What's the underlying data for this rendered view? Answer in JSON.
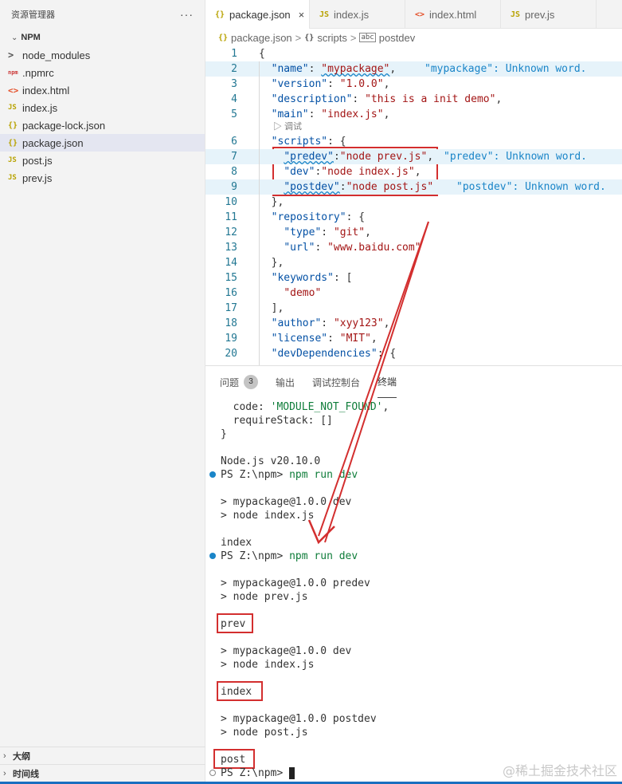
{
  "sidebar": {
    "title": "资源管理器",
    "more": "···",
    "section": "NPM",
    "items": [
      {
        "label": "node_modules",
        "icon": "chevron-right-icon",
        "glyph": ">",
        "type": "folder"
      },
      {
        "label": ".npmrc",
        "icon": "npm-icon",
        "glyph": "npm",
        "type": "npm"
      },
      {
        "label": "index.html",
        "icon": "html-icon",
        "glyph": "<>",
        "type": "html"
      },
      {
        "label": "index.js",
        "icon": "js-icon",
        "glyph": "JS",
        "type": "js"
      },
      {
        "label": "package-lock.json",
        "icon": "json-icon",
        "glyph": "{}",
        "type": "json"
      },
      {
        "label": "package.json",
        "icon": "json-icon",
        "glyph": "{}",
        "type": "json",
        "active": true
      },
      {
        "label": "post.js",
        "icon": "js-icon",
        "glyph": "JS",
        "type": "js"
      },
      {
        "label": "prev.js",
        "icon": "js-icon",
        "glyph": "JS",
        "type": "js"
      }
    ],
    "outline": "大纲",
    "timeline": "时间线"
  },
  "tabs": [
    {
      "label": "package.json",
      "glyph": "{}",
      "active": true,
      "close": "×"
    },
    {
      "label": "index.js",
      "glyph": "JS"
    },
    {
      "label": "index.html",
      "glyph": "<>"
    },
    {
      "label": "prev.js",
      "glyph": "JS"
    }
  ],
  "breadcrumb": {
    "file": "package.json",
    "sep1": ">",
    "part2": "scripts",
    "sep2": ">",
    "part3": "postdev"
  },
  "editor": {
    "codelens": "▷ 调试",
    "lines": [
      {
        "n": "1",
        "code": "{"
      },
      {
        "n": "2",
        "code": "  \"name\": \"mypackage\",",
        "warn": "\"mypackage\": Unknown word."
      },
      {
        "n": "3",
        "code": "  \"version\": \"1.0.0\","
      },
      {
        "n": "4",
        "code": "  \"description\": \"this is a init demo\","
      },
      {
        "n": "5",
        "code": "  \"main\": \"index.js\","
      },
      {
        "n": "6",
        "code": "  \"scripts\": {"
      },
      {
        "n": "7",
        "code": "    \"predev\":\"node prev.js\",",
        "warn": "\"predev\": Unknown word."
      },
      {
        "n": "8",
        "code": "    \"dev\":\"node index.js\","
      },
      {
        "n": "9",
        "code": "    \"postdev\":\"node post.js\"",
        "warn": "\"postdev\": Unknown word."
      },
      {
        "n": "10",
        "code": "  },"
      },
      {
        "n": "11",
        "code": "  \"repository\": {"
      },
      {
        "n": "12",
        "code": "    \"type\": \"git\","
      },
      {
        "n": "13",
        "code": "    \"url\": \"www.baidu.com\""
      },
      {
        "n": "14",
        "code": "  },"
      },
      {
        "n": "15",
        "code": "  \"keywords\": ["
      },
      {
        "n": "16",
        "code": "    \"demo\""
      },
      {
        "n": "17",
        "code": "  ],"
      },
      {
        "n": "18",
        "code": "  \"author\": \"xyy123\","
      },
      {
        "n": "19",
        "code": "  \"license\": \"MIT\","
      },
      {
        "n": "20",
        "code": "  \"devDependencies\": {"
      }
    ]
  },
  "panel": {
    "tabs": [
      {
        "label": "问题",
        "badge": "3"
      },
      {
        "label": "输出"
      },
      {
        "label": "调试控制台"
      },
      {
        "label": "终端",
        "active": true
      }
    ]
  },
  "terminal": {
    "lines": [
      "  code: 'MODULE_NOT_FOUND',",
      "  requireStack: []",
      "}",
      "",
      "Node.js v20.10.0",
      "PS Z:\\npm> npm run dev",
      "",
      "> mypackage@1.0.0 dev",
      "> node index.js",
      "",
      "index",
      "PS Z:\\npm> npm run dev",
      "",
      "> mypackage@1.0.0 predev",
      "> node prev.js",
      "",
      "prev",
      "",
      "> mypackage@1.0.0 dev",
      "> node index.js",
      "",
      "index",
      "",
      "> mypackage@1.0.0 postdev",
      "> node post.js",
      "",
      "post",
      "PS Z:\\npm> "
    ],
    "prompt": "PS Z:\\npm>",
    "cmd": "npm run dev",
    "module_not_found": "'MODULE_NOT_FOUND'"
  },
  "watermark": "@稀土掘金技术社区",
  "colors": {
    "annotation": "#d32f2f",
    "accent": "#1a85c8"
  }
}
